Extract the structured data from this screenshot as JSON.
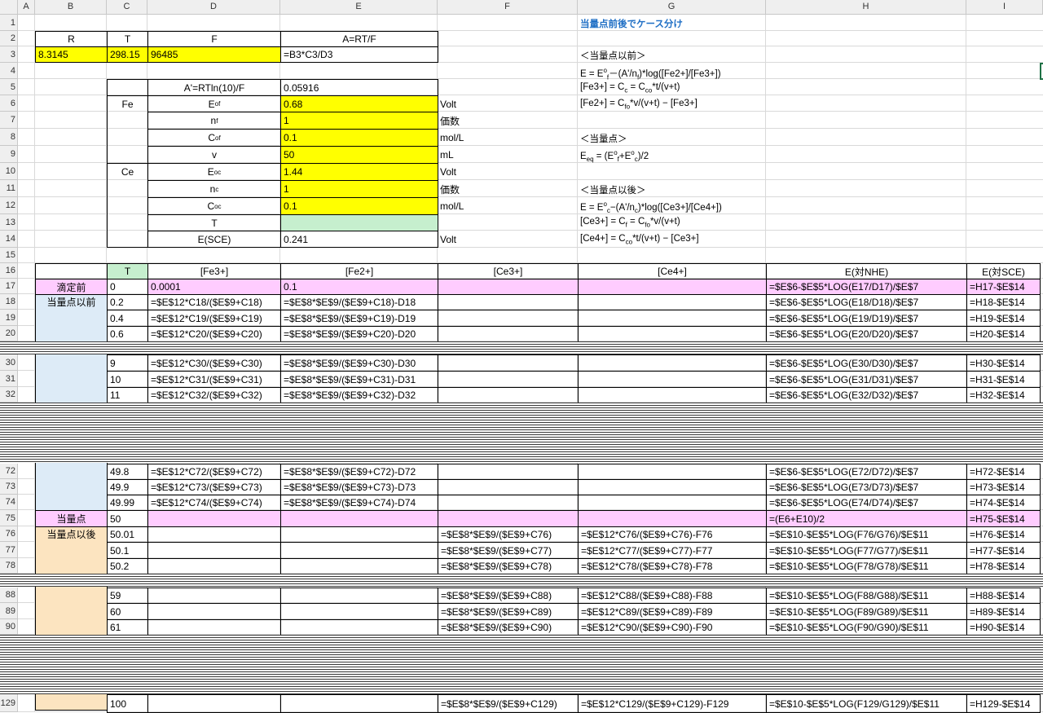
{
  "columns": [
    "A",
    "B",
    "C",
    "D",
    "E",
    "F",
    "G",
    "H",
    "I"
  ],
  "row_numbers": [
    "1",
    "2",
    "3",
    "4",
    "5",
    "6",
    "7",
    "8",
    "9",
    "10",
    "11",
    "12",
    "13",
    "14",
    "15",
    "16",
    "17",
    "18",
    "19",
    "20",
    "30",
    "31",
    "32",
    "72",
    "73",
    "74",
    "75",
    "76",
    "77",
    "78",
    "88",
    "89",
    "90",
    "129"
  ],
  "top": {
    "R_h": "R",
    "T_h": "T",
    "F_h": "F",
    "ART_h": "A=RT/F",
    "R_v": "8.3145",
    "T_v": "298.15",
    "F_v": "96485",
    "A_v": "=B3*C3/D3"
  },
  "params": {
    "a_label": "A'=RTln(10)/F",
    "a_value": "0.05916",
    "fe": "Fe",
    "ce": "Ce",
    "e0f": "E°f",
    "e0f_v": "0.68",
    "volt": "Volt",
    "nf": "nf",
    "nf_v": "1",
    "valence": "価数",
    "cof": "Cof",
    "cof_v": "0.1",
    "moll": "mol/L",
    "v": "v",
    "v_v": "50",
    "ml": "mL",
    "e0c": "E°c",
    "e0c_v": "1.44",
    "nc": "nc",
    "nc_v": "1",
    "coc": "Coc",
    "coc_v": "0.1",
    "t": "T",
    "t_v": "",
    "esce": "E(SCE)",
    "esce_v": "0.241"
  },
  "notes": {
    "title": "当量点前後でケース分け",
    "before": "＜当量点以前＞",
    "eq1": "E = E°f－(A'/nf)*log([Fe2+]/[Fe3+])",
    "eq2": "[Fe3+] = Cc = Coc*t/(v+t)",
    "eq3": "[Fe2+] = Cfo*v/(v+t) − [Fe3+]",
    "at": "＜当量点＞",
    "eq4": "Eeq = (E°f+E°c)/2",
    "after": "＜当量点以後＞",
    "eq5": "E = E°c−(A'/nc)*log([Ce3+]/[Ce4+])",
    "eq6": "[Ce3+] = Cf = Cfo*v/(v+t)",
    "eq7": "[Ce4+] = Coc*t/(v+t) − [Ce3+]"
  },
  "table": {
    "headers": [
      "T",
      "[Fe3+]",
      "[Fe2+]",
      "[Ce3+]",
      "[Ce4+]",
      "E(対NHE)",
      "E(対SCE)"
    ],
    "groups": [
      "滴定前",
      "当量点以前",
      "当量点",
      "当量点以後"
    ],
    "rows": [
      {
        "t": "0",
        "fe3": "0.0001",
        "fe2": "0.1",
        "ce3": "",
        "ce4": "",
        "enhe": "=$E$6-$E$5*LOG(E17/D17)/$E$7",
        "esce": "=H17-$E$14"
      },
      {
        "t": "0.2",
        "fe3": "=$E$12*C18/($E$9+C18)",
        "fe2": "=$E$8*$E$9/($E$9+C18)-D18",
        "ce3": "",
        "ce4": "",
        "enhe": "=$E$6-$E$5*LOG(E18/D18)/$E$7",
        "esce": "=H18-$E$14"
      },
      {
        "t": "0.4",
        "fe3": "=$E$12*C19/($E$9+C19)",
        "fe2": "=$E$8*$E$9/($E$9+C19)-D19",
        "ce3": "",
        "ce4": "",
        "enhe": "=$E$6-$E$5*LOG(E19/D19)/$E$7",
        "esce": "=H19-$E$14"
      },
      {
        "t": "0.6",
        "fe3": "=$E$12*C20/($E$9+C20)",
        "fe2": "=$E$8*$E$9/($E$9+C20)-D20",
        "ce3": "",
        "ce4": "",
        "enhe": "=$E$6-$E$5*LOG(E20/D20)/$E$7",
        "esce": "=H20-$E$14"
      },
      {
        "t": "9",
        "fe3": "=$E$12*C30/($E$9+C30)",
        "fe2": "=$E$8*$E$9/($E$9+C30)-D30",
        "ce3": "",
        "ce4": "",
        "enhe": "=$E$6-$E$5*LOG(E30/D30)/$E$7",
        "esce": "=H30-$E$14"
      },
      {
        "t": "10",
        "fe3": "=$E$12*C31/($E$9+C31)",
        "fe2": "=$E$8*$E$9/($E$9+C31)-D31",
        "ce3": "",
        "ce4": "",
        "enhe": "=$E$6-$E$5*LOG(E31/D31)/$E$7",
        "esce": "=H31-$E$14"
      },
      {
        "t": "11",
        "fe3": "=$E$12*C32/($E$9+C32)",
        "fe2": "=$E$8*$E$9/($E$9+C32)-D32",
        "ce3": "",
        "ce4": "",
        "enhe": "=$E$6-$E$5*LOG(E32/D32)/$E$7",
        "esce": "=H32-$E$14"
      },
      {
        "t": "49.8",
        "fe3": "=$E$12*C72/($E$9+C72)",
        "fe2": "=$E$8*$E$9/($E$9+C72)-D72",
        "ce3": "",
        "ce4": "",
        "enhe": "=$E$6-$E$5*LOG(E72/D72)/$E$7",
        "esce": "=H72-$E$14"
      },
      {
        "t": "49.9",
        "fe3": "=$E$12*C73/($E$9+C73)",
        "fe2": "=$E$8*$E$9/($E$9+C73)-D73",
        "ce3": "",
        "ce4": "",
        "enhe": "=$E$6-$E$5*LOG(E73/D73)/$E$7",
        "esce": "=H73-$E$14"
      },
      {
        "t": "49.99",
        "fe3": "=$E$12*C74/($E$9+C74)",
        "fe2": "=$E$8*$E$9/($E$9+C74)-D74",
        "ce3": "",
        "ce4": "",
        "enhe": "=$E$6-$E$5*LOG(E74/D74)/$E$7",
        "esce": "=H74-$E$14"
      },
      {
        "t": "50",
        "fe3": "",
        "fe2": "",
        "ce3": "",
        "ce4": "",
        "enhe": "=(E6+E10)/2",
        "esce": "=H75-$E$14"
      },
      {
        "t": "50.01",
        "fe3": "",
        "fe2": "",
        "ce3": "=$E$8*$E$9/($E$9+C76)",
        "ce4": "=$E$12*C76/($E$9+C76)-F76",
        "enhe": "=$E$10-$E$5*LOG(F76/G76)/$E$11",
        "esce": "=H76-$E$14"
      },
      {
        "t": "50.1",
        "fe3": "",
        "fe2": "",
        "ce3": "=$E$8*$E$9/($E$9+C77)",
        "ce4": "=$E$12*C77/($E$9+C77)-F77",
        "enhe": "=$E$10-$E$5*LOG(F77/G77)/$E$11",
        "esce": "=H77-$E$14"
      },
      {
        "t": "50.2",
        "fe3": "",
        "fe2": "",
        "ce3": "=$E$8*$E$9/($E$9+C78)",
        "ce4": "=$E$12*C78/($E$9+C78)-F78",
        "enhe": "=$E$10-$E$5*LOG(F78/G78)/$E$11",
        "esce": "=H78-$E$14"
      },
      {
        "t": "59",
        "fe3": "",
        "fe2": "",
        "ce3": "=$E$8*$E$9/($E$9+C88)",
        "ce4": "=$E$12*C88/($E$9+C88)-F88",
        "enhe": "=$E$10-$E$5*LOG(F88/G88)/$E$11",
        "esce": "=H88-$E$14"
      },
      {
        "t": "60",
        "fe3": "",
        "fe2": "",
        "ce3": "=$E$8*$E$9/($E$9+C89)",
        "ce4": "=$E$12*C89/($E$9+C89)-F89",
        "enhe": "=$E$10-$E$5*LOG(F89/G89)/$E$11",
        "esce": "=H89-$E$14"
      },
      {
        "t": "61",
        "fe3": "",
        "fe2": "",
        "ce3": "=$E$8*$E$9/($E$9+C90)",
        "ce4": "=$E$12*C90/($E$9+C90)-F90",
        "enhe": "=$E$10-$E$5*LOG(F90/G90)/$E$11",
        "esce": "=H90-$E$14"
      },
      {
        "t": "100",
        "fe3": "",
        "fe2": "",
        "ce3": "=$E$8*$E$9/($E$9+C129)",
        "ce4": "=$E$12*C129/($E$9+C129)-F129",
        "enhe": "=$E$10-$E$5*LOG(F129/G129)/$E$11",
        "esce": "=H129-$E$14"
      }
    ]
  }
}
